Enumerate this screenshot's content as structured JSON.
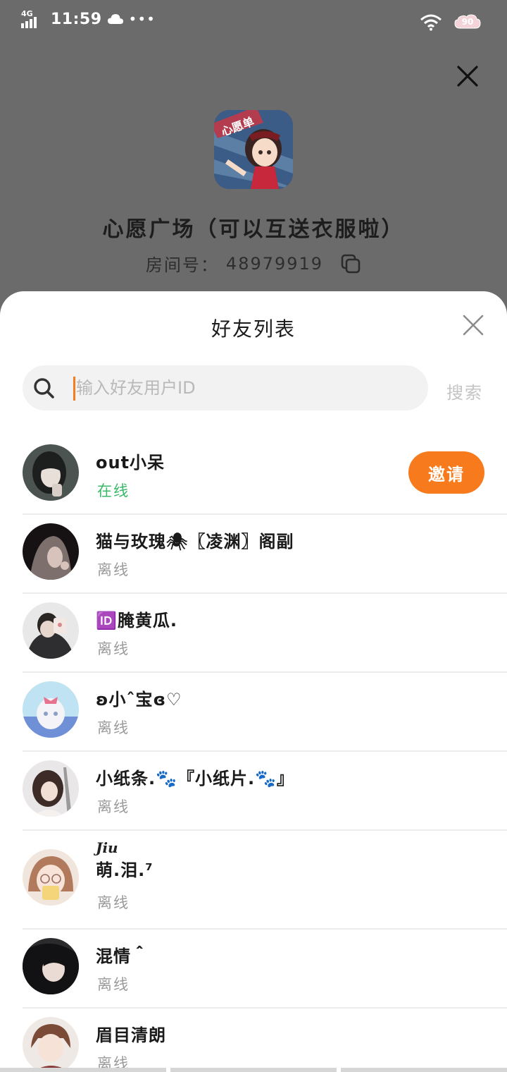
{
  "status_bar": {
    "network": "4G",
    "time": "11:59",
    "dots": "•••",
    "battery_level": "90"
  },
  "room": {
    "name": "心愿广场（可以互送衣服啦）",
    "id_label": "房间号：",
    "id_value": "48979919",
    "cover_text": "心愿单"
  },
  "sheet": {
    "title": "好友列表",
    "search": {
      "placeholder": "输入好友用户ID",
      "button_label": "搜索"
    },
    "friends": [
      {
        "name": "out小呆",
        "status": "在线",
        "online": true,
        "invite_label": "邀请"
      },
      {
        "name": "猫与玫瑰🕷〖凌渊〗阁副",
        "status": "离线",
        "online": false
      },
      {
        "name": "🆔腌黄瓜.",
        "status": "离线",
        "online": false
      },
      {
        "name": "ʚ小ˆ宝ɞ♡",
        "status": "离线",
        "online": false
      },
      {
        "name": "小纸条.🐾『小纸片.🐾』",
        "status": "离线",
        "online": false
      },
      {
        "name_script": "Jiu",
        "name": "萌.泪.⁷",
        "status": "离线",
        "online": false
      },
      {
        "name": "混情＾",
        "status": "离线",
        "online": false
      },
      {
        "name": "眉目清朗",
        "status": "离线",
        "online": false
      }
    ]
  },
  "colors": {
    "accent": "#f77b1d",
    "online": "#39b967",
    "offline": "#9b9b9b",
    "overlay": "#6b6b6b"
  }
}
